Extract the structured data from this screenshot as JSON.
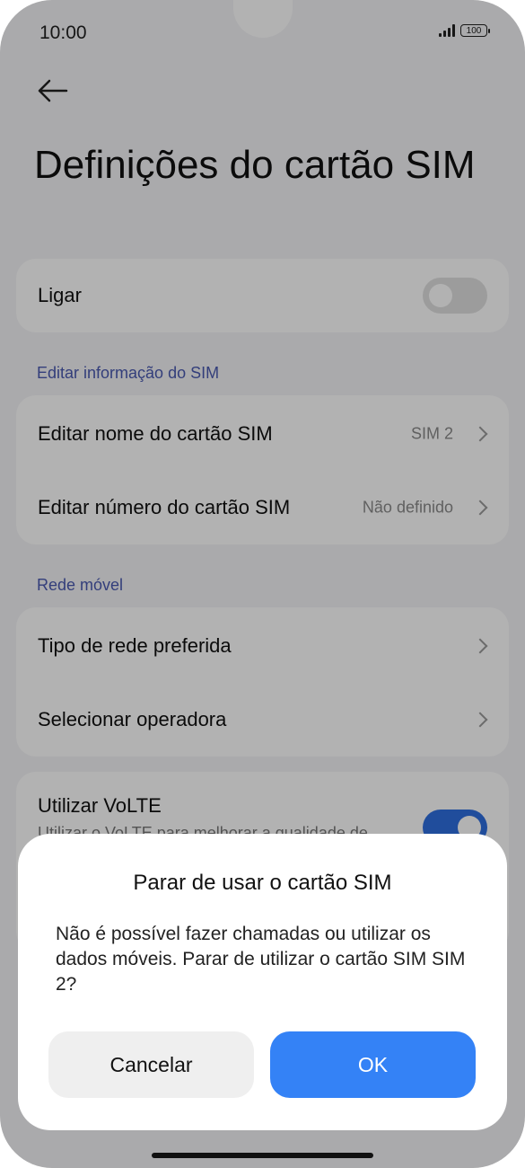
{
  "status_bar": {
    "time": "10:00",
    "battery": "100"
  },
  "header": {
    "title": "Definições do cartão SIM"
  },
  "power": {
    "label": "Ligar",
    "enabled": false
  },
  "sections": {
    "sim_info": {
      "header": "Editar informação do SIM"
    },
    "mobile_network": {
      "header": "Rede móvel"
    }
  },
  "sim_info_items": [
    {
      "label": "Editar nome do cartão SIM",
      "value": "SIM 2"
    },
    {
      "label": "Editar número do cartão SIM",
      "value": "Não definido"
    }
  ],
  "network_items": [
    {
      "label": "Tipo de rede preferida"
    },
    {
      "label": "Selecionar operadora"
    }
  ],
  "volte": {
    "label": "Utilizar VoLTE",
    "subtitle": "Utilizar o VoLTE para melhorar a qualidade de",
    "enabled": true
  },
  "dialog": {
    "title": "Parar de usar o cartão SIM",
    "message": "Não é possível fazer chamadas ou utilizar os dados móveis. Parar de utilizar o cartão SIM SIM 2?",
    "cancel_label": "Cancelar",
    "ok_label": "OK"
  },
  "colors": {
    "accent": "#3482f6",
    "section_header": "#4a5ab0",
    "toggle_on": "#2f6fe0"
  }
}
